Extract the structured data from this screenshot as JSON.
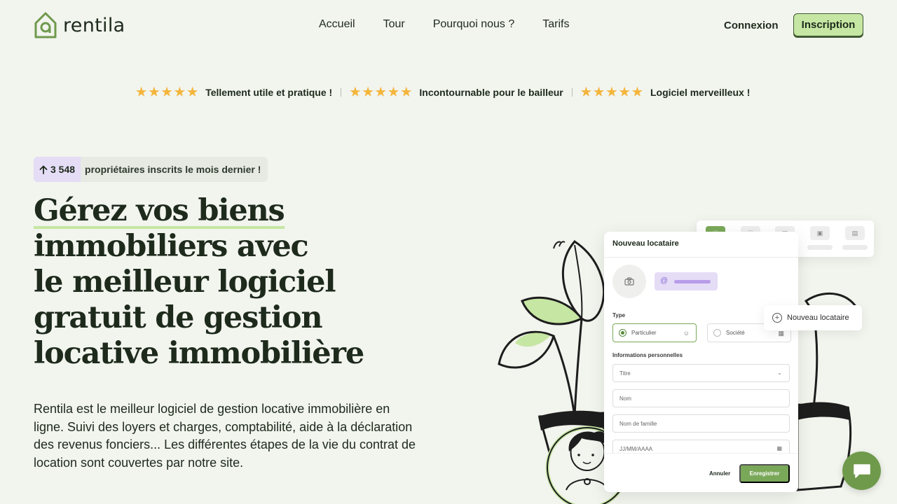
{
  "brand": {
    "name": "rentila",
    "accent": "#7aa859",
    "accent_light": "#c6e6a3",
    "lavender": "#e5dcf6"
  },
  "nav": {
    "items": [
      {
        "label": "Accueil"
      },
      {
        "label": "Tour"
      },
      {
        "label": "Pourquoi nous ?"
      },
      {
        "label": "Tarifs"
      }
    ],
    "login_label": "Connexion",
    "signup_label": "Inscription"
  },
  "reviews": [
    {
      "stars": 5,
      "text": "Tellement utile et pratique !"
    },
    {
      "stars": 5,
      "text": "Incontournable pour le bailleur"
    },
    {
      "stars": 5,
      "text": "Logiciel merveilleux !"
    }
  ],
  "badge": {
    "count": "3 548",
    "text": "propriétaires inscrits le mois dernier !"
  },
  "hero": {
    "title_lines": [
      "Gérez vos biens",
      "immobiliers avec",
      "le meilleur logiciel",
      "gratuit de gestion",
      "locative immobilière"
    ],
    "description": "Rentila est le meilleur logiciel de gestion locative immobilière en ligne. Suivi des loyers et charges, comptabilité, aide à la déclaration des revenus fonciers... Les différentes étapes de la vie du contrat de location sont couvertes par notre site."
  },
  "form_card": {
    "title": "Nouveau locataire",
    "type_label": "Type",
    "type_options": [
      {
        "label": "Particulier",
        "selected": true,
        "icon": "person-icon"
      },
      {
        "label": "Société",
        "selected": false,
        "icon": "building-icon"
      }
    ],
    "section_label": "Informations personnelles",
    "fields": [
      {
        "placeholder": "Titre",
        "icon": "chevron-down-icon"
      },
      {
        "placeholder": "Nom"
      },
      {
        "placeholder": "Nom de famille"
      },
      {
        "placeholder": "JJ/MM/AAAA",
        "icon": "calendar-icon"
      }
    ],
    "cancel_label": "Annuler",
    "save_label": "Enregistrer"
  },
  "floating_chip": {
    "label": "Nouveau locataire"
  }
}
